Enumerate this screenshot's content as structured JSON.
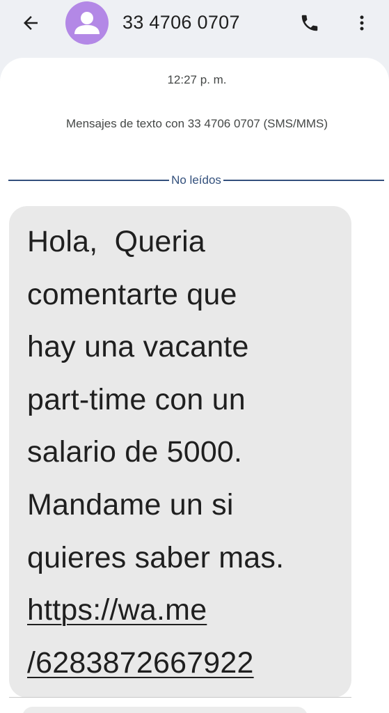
{
  "header": {
    "contact_name": "33 4706 0707",
    "back_icon": "arrow-back-icon",
    "avatar_icon": "person-icon",
    "call_icon": "phone-icon",
    "more_icon": "more-vert-icon",
    "avatar_color": "#b388e6"
  },
  "conversation": {
    "timestamp": "12:27 p. m.",
    "info": "Mensajes de texto con 33 4706 0707 (SMS/MMS)",
    "unread_divider": "No leídos",
    "divider_color": "#33507c"
  },
  "message": {
    "lines": [
      "Hola,  Queria",
      "comentarte que",
      "hay una vacante",
      "part-time con un",
      "salario de 5000.",
      "Mandame un si",
      "quieres saber mas."
    ],
    "link_lines": [
      "https://wa.me",
      "/6283872667922"
    ],
    "bubble_color": "#e9e9e9"
  }
}
